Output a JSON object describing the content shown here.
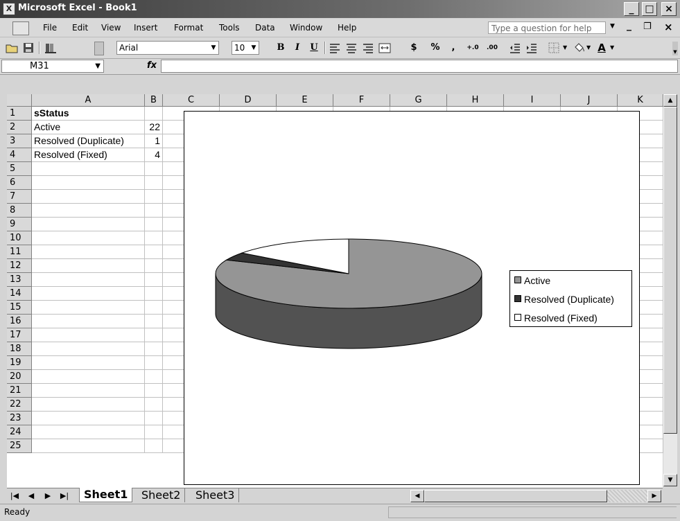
{
  "window": {
    "title": "Microsoft Excel - Book1",
    "app_icon_glyph": "X"
  },
  "caption_buttons": {
    "minimize": "_",
    "maximize": "□",
    "close": "×"
  },
  "menu": {
    "items": [
      "File",
      "Edit",
      "View",
      "Insert",
      "Format",
      "Tools",
      "Data",
      "Window",
      "Help"
    ],
    "help_box_placeholder": "Type a question for help"
  },
  "toolbar": {
    "font_name": "Arial",
    "font_size": "10",
    "bold": "B",
    "italic": "I",
    "underline": "U",
    "currency": "$",
    "percent": "%",
    "comma": ",",
    "increase_decimal": "+.0",
    "decrease_decimal": ".00",
    "font_color_label": "A"
  },
  "formula_bar": {
    "name_box": "M31",
    "fx_label": "fx",
    "formula": ""
  },
  "columns": [
    "A",
    "B",
    "C",
    "D",
    "E",
    "F",
    "G",
    "H",
    "I",
    "J",
    "K"
  ],
  "rows": [
    "1",
    "2",
    "3",
    "4",
    "5",
    "6",
    "7",
    "8",
    "9",
    "10",
    "11",
    "12",
    "13",
    "14",
    "15",
    "16",
    "17",
    "18",
    "19",
    "20",
    "21",
    "22",
    "23",
    "24",
    "25"
  ],
  "cells": {
    "A1": "sStatus",
    "A2": "Active",
    "B2": "22",
    "A3": "Resolved (Duplicate)",
    "B3": "1",
    "A4": "Resolved (Fixed)",
    "B4": "4"
  },
  "chart_data": {
    "type": "pie",
    "style": "3d",
    "categories": [
      "Active",
      "Resolved (Duplicate)",
      "Resolved (Fixed)"
    ],
    "values": [
      22,
      1,
      4
    ],
    "colors": [
      "#959595",
      "#333333",
      "#ffffff"
    ],
    "title": "",
    "legend_position": "right"
  },
  "sheets": {
    "tabs": [
      "Sheet1",
      "Sheet2",
      "Sheet3"
    ],
    "active": "Sheet1"
  },
  "status": {
    "text": "Ready"
  }
}
